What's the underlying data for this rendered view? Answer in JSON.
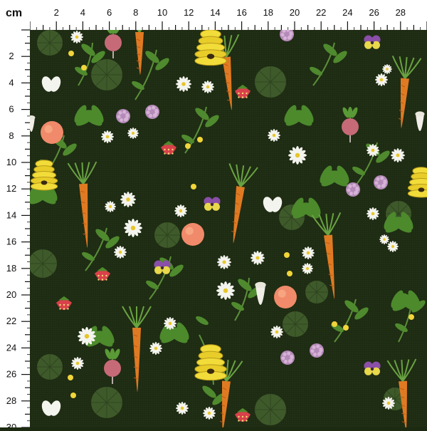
{
  "ruler": {
    "unit": "cm",
    "top_ticks": [
      "2",
      "4",
      "6",
      "8",
      "10",
      "12",
      "14",
      "16",
      "18",
      "20",
      "22",
      "24",
      "26",
      "28"
    ],
    "left_ticks": [
      "2",
      "4",
      "6",
      "8",
      "10",
      "12",
      "14",
      "16",
      "18",
      "20",
      "22",
      "24",
      "26",
      "28",
      "30"
    ]
  },
  "colors": {
    "ruler_bg": "#ffffff",
    "ruler_ink": "#111111",
    "fabric_bg": "#1f2d14"
  },
  "motifs": [
    "carrot",
    "strawberry",
    "beehive",
    "white-daisy",
    "pansy",
    "radish",
    "clover-flower",
    "turnip",
    "peach",
    "butterfly",
    "lily-pad-leaf",
    "herb-sprig"
  ]
}
